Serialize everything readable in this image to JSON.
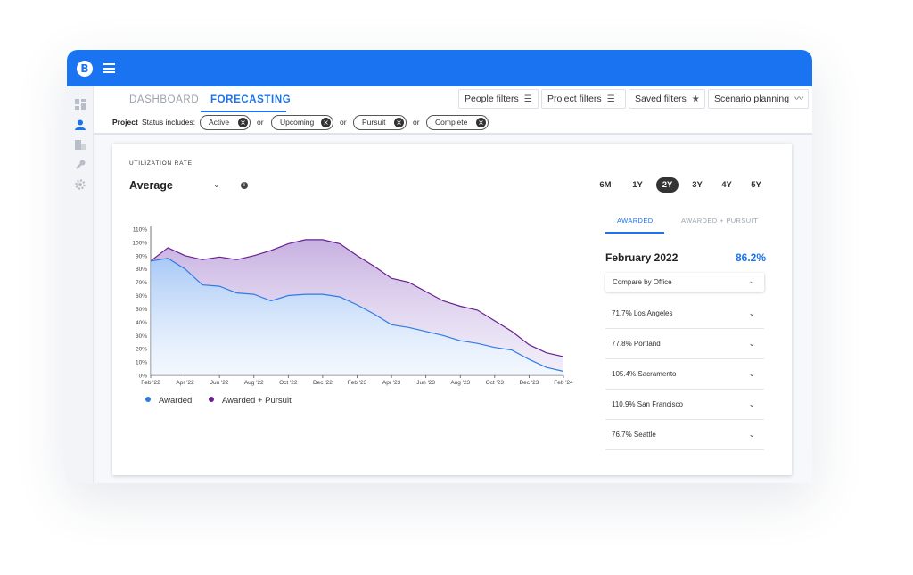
{
  "nav": {
    "tabs": [
      {
        "label": "DASHBOARD"
      },
      {
        "label": "FORECASTING"
      }
    ],
    "filters": [
      {
        "label": "People filters",
        "icon": "filter-icon"
      },
      {
        "label": "Project filters",
        "icon": "filter-icon"
      },
      {
        "label": "Saved filters",
        "icon": "star-icon"
      },
      {
        "label": "Scenario planning",
        "icon": "trend-icon"
      }
    ]
  },
  "filter_bar": {
    "label": "Project",
    "status_label": "Status includes:",
    "chips": [
      "Active",
      "Upcoming",
      "Pursuit",
      "Complete"
    ],
    "separator": "or"
  },
  "card": {
    "section_title": "UTILIZATION RATE",
    "select_value": "Average",
    "ranges": [
      "6M",
      "1Y",
      "2Y",
      "3Y",
      "4Y",
      "5Y"
    ],
    "active_range": "2Y",
    "right_tabs": [
      "AWARDED",
      "AWARDED + PURSUIT"
    ],
    "active_right_tab": "AWARDED",
    "month": "February 2022",
    "month_value": "86.2%",
    "compare_label": "Compare by Office",
    "offices": [
      "71.7% Los Angeles",
      "77.8% Portland",
      "105.4% Sacramento",
      "110.9% San Francisco",
      "76.7% Seattle"
    ]
  },
  "colors": {
    "brand": "#1a73f0",
    "awarded": "#2f7be5",
    "awarded_pursuit": "#6a1f91"
  },
  "chart_data": {
    "type": "area",
    "title": "",
    "xlabel": "",
    "ylabel": "",
    "ylim": [
      0,
      110
    ],
    "yticks": [
      "0%",
      "10%",
      "20%",
      "30%",
      "40%",
      "50%",
      "60%",
      "70%",
      "80%",
      "90%",
      "100%",
      "110%"
    ],
    "xticks": [
      "Feb '22",
      "Apr '22",
      "Jun '22",
      "Aug '22",
      "Oct '22",
      "Dec '22",
      "Feb '23",
      "Apr '23",
      "Jun '23",
      "Aug '23",
      "Oct '23",
      "Dec '23",
      "Feb '24"
    ],
    "x_months": [
      0,
      1,
      2,
      3,
      4,
      5,
      6,
      7,
      8,
      9,
      10,
      11,
      12,
      13,
      14,
      15,
      16,
      17,
      18,
      19,
      20,
      21,
      22,
      23,
      24
    ],
    "legend": "bottom-left",
    "series": [
      {
        "name": "Awarded",
        "values": [
          86,
          88,
          80,
          68,
          67,
          62,
          61,
          56,
          60,
          61,
          61,
          59,
          53,
          46,
          38,
          36,
          33,
          30,
          26,
          24,
          21,
          19,
          12,
          6,
          3
        ]
      },
      {
        "name": "Awarded + Pursuit",
        "values": [
          86,
          96,
          90,
          87,
          89,
          87,
          90,
          94,
          99,
          102,
          102,
          99,
          90,
          82,
          73,
          70,
          63,
          56,
          52,
          49,
          41,
          33,
          23,
          17,
          14
        ]
      }
    ]
  }
}
